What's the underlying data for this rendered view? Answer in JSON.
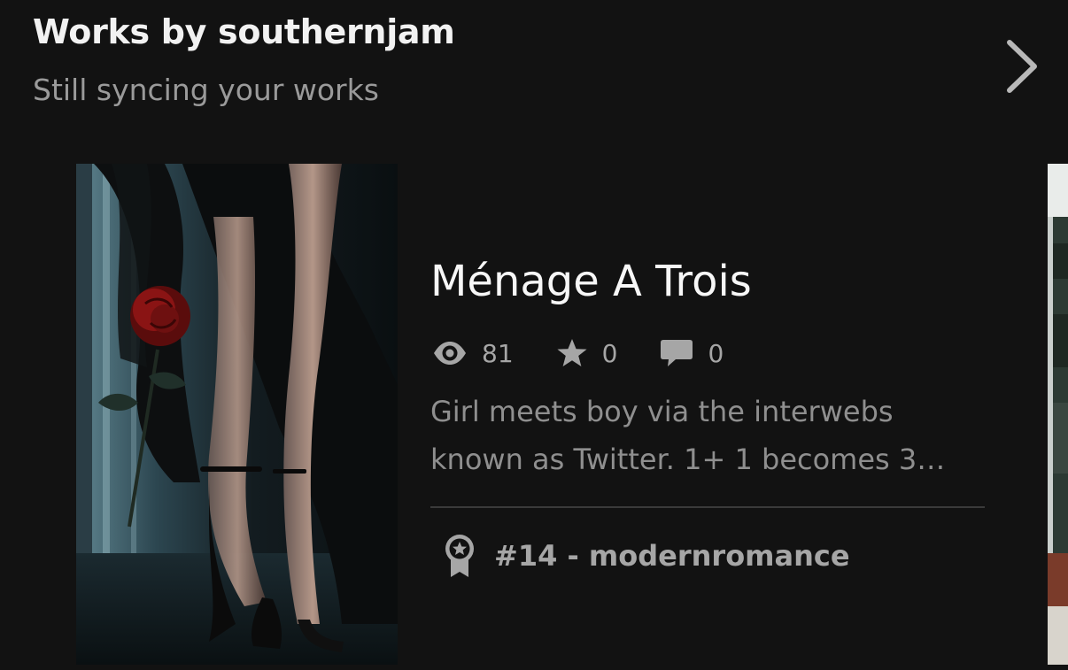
{
  "header": {
    "title": "Works by southernjam",
    "subtitle": "Still syncing your works",
    "chevron_icon": "chevron-right-icon"
  },
  "story": {
    "title": "Ménage A Trois",
    "stats": {
      "views": "81",
      "votes": "0",
      "comments": "0"
    },
    "description_lines": [
      "Girl meets boy via the interwebs",
      "known as Twitter. 1+ 1 becomes 3…"
    ],
    "ranking": "#14 - modernromance",
    "ranking_icon": "award-badge-icon"
  },
  "colors": {
    "background": "#121212",
    "title": "#f2f2f2",
    "muted": "#9a9a9a",
    "stat": "#a6a6a6",
    "divider": "#3a3a3a"
  }
}
